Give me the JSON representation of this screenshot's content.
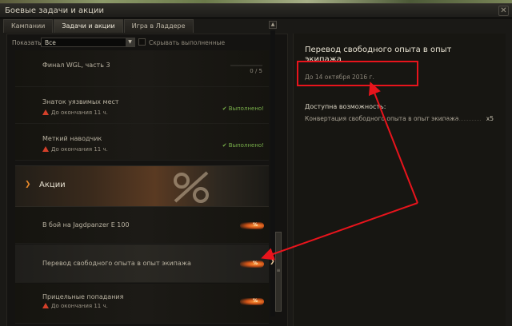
{
  "window": {
    "title": "Боевые задачи и акции",
    "close_glyph": "✕"
  },
  "tabs": [
    "Кампании",
    "Задачи и акции",
    "Игра в Ладдере"
  ],
  "filter": {
    "show_label": "Показать:",
    "selected": "Все",
    "hide_done_label": "Скрывать выполненные"
  },
  "quests": [
    {
      "title": "Финал WGL, часть 3",
      "progress": "0 / 5"
    },
    {
      "title": "Знаток уязвимых мест",
      "remaining": "До окончания 11 ч.",
      "status": "Выполнено!"
    },
    {
      "title": "Меткий наводчик",
      "remaining": "До окончания 11 ч.",
      "status": "Выполнено!"
    }
  ],
  "section": {
    "title": "Акции"
  },
  "actions": [
    {
      "title": "В бой на Jagdpanzer E 100",
      "badge": "%"
    },
    {
      "title": "Перевод свободного опыта в опыт экипажа",
      "badge": "%"
    },
    {
      "title": "Прицельные попадания",
      "remaining": "До окончания 11 ч.",
      "badge": "%"
    }
  ],
  "detail": {
    "title": "Перевод свободного опыта в опыт экипажа",
    "deadline": "До 14 октября 2016 г.",
    "available_label": "Доступна возможность:",
    "reward_name": "Конвертация свободного опыта в опыт экипажа",
    "reward_mult": "x5"
  },
  "colors": {
    "annotation": "#e8141c",
    "done_green": "#79b04a",
    "warning": "#d4402a",
    "accent": "#e88a2a"
  }
}
